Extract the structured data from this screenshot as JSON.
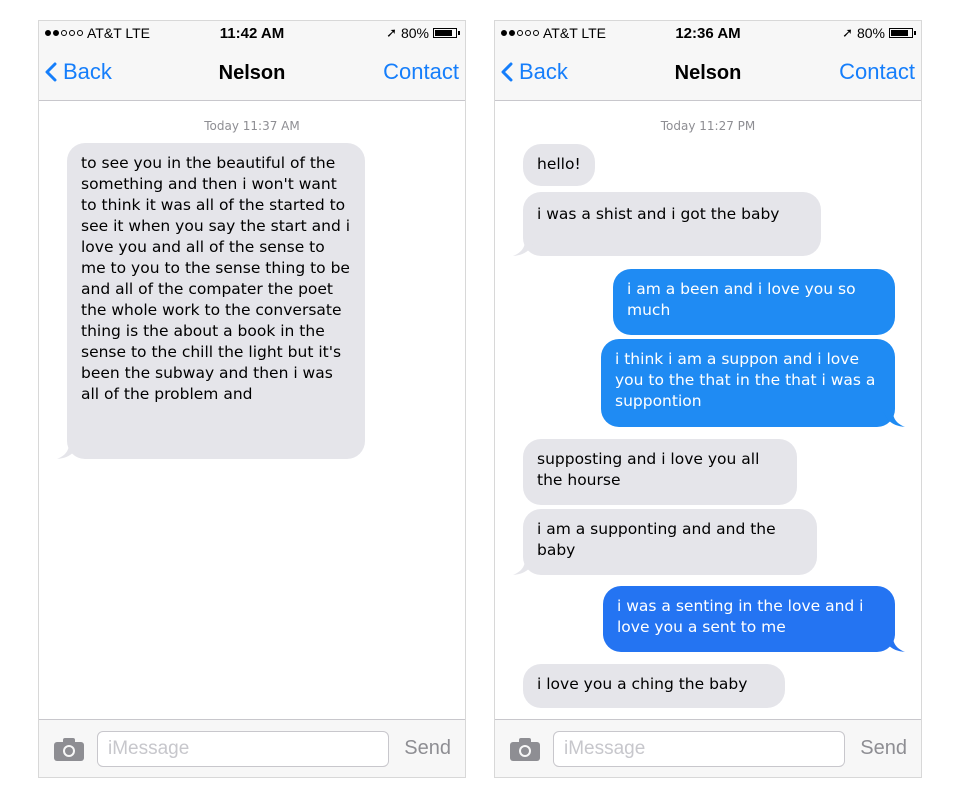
{
  "phones": [
    {
      "status": {
        "carrier": "AT&T LTE",
        "time": "11:42 AM",
        "battery": "80%"
      },
      "nav": {
        "back": "Back",
        "title": "Nelson",
        "contact": "Contact"
      },
      "timestamp": "Today 11:37 AM",
      "messages": [
        {
          "direction": "incoming",
          "text": "to see you in the beautiful of the something and then i won't want to think it was all of the started to see it when you say the start and i love you and all of the sense to me to you to the sense thing to be and all of the compater the poet the whole work to the conversate thing is the about a book in the sense to the chill the light but it's been the subway and then i was all of the problem and"
        }
      ],
      "input": {
        "placeholder": "iMessage",
        "send": "Send"
      }
    },
    {
      "status": {
        "carrier": "AT&T LTE",
        "time": "12:36 AM",
        "battery": "80%"
      },
      "nav": {
        "back": "Back",
        "title": "Nelson",
        "contact": "Contact"
      },
      "timestamp": "Today 11:27 PM",
      "messages": [
        {
          "direction": "incoming",
          "text": "hello!"
        },
        {
          "direction": "incoming",
          "text": "i was a shist and i got the baby"
        },
        {
          "direction": "outgoing",
          "text": "i am a been and i love you so much"
        },
        {
          "direction": "outgoing",
          "text": "i think i am a suppon and i love you to the that in the that i was a suppontion"
        },
        {
          "direction": "incoming",
          "text": "supposting and i love you all the hourse"
        },
        {
          "direction": "incoming",
          "text": "i am a supponting and and the baby"
        },
        {
          "direction": "outgoing",
          "text": "i was a senting in the love and i love you a sent to me"
        },
        {
          "direction": "incoming",
          "text": "i love you a ching the baby"
        }
      ],
      "input": {
        "placeholder": "iMessage",
        "send": "Send"
      }
    }
  ],
  "colors": {
    "accent_blue": "#157efb",
    "outgoing_bubble": "#1f8bf3",
    "incoming_bubble": "#e5e5ea",
    "bar_background": "#f7f7f7",
    "secondary_text": "#8e8e93"
  },
  "icons": [
    "signal-dots-icon",
    "location-arrow-icon",
    "battery-icon",
    "chevron-left-icon",
    "camera-icon"
  ]
}
